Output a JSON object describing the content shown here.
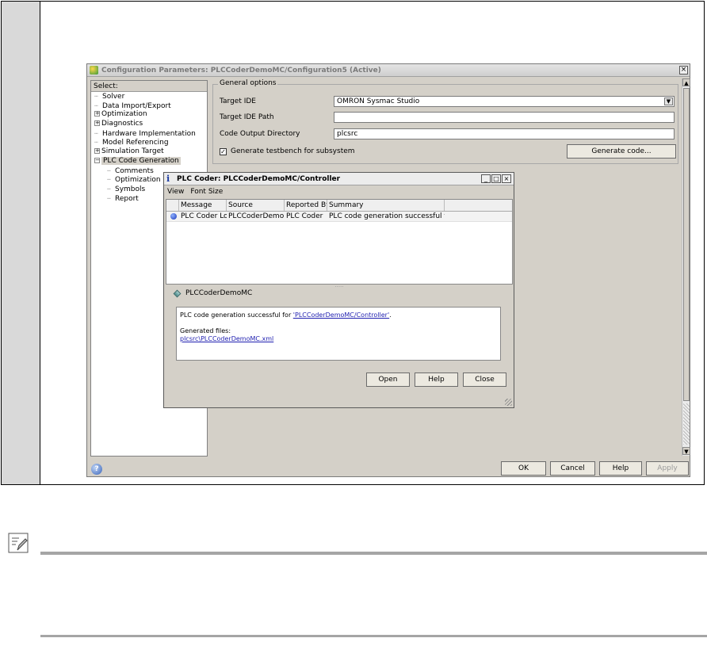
{
  "config_window": {
    "title": "Configuration Parameters: PLCCoderDemoMC/Configuration5 (Active)",
    "close_glyph": "×",
    "tree": {
      "header": "Select:",
      "items": [
        {
          "label": "Solver",
          "level": 0,
          "expander": ""
        },
        {
          "label": "Data Import/Export",
          "level": 0,
          "expander": ""
        },
        {
          "label": "Optimization",
          "level": 0,
          "expander": "+"
        },
        {
          "label": "Diagnostics",
          "level": 0,
          "expander": "+"
        },
        {
          "label": "Hardware Implementation",
          "level": 0,
          "expander": ""
        },
        {
          "label": "Model Referencing",
          "level": 0,
          "expander": ""
        },
        {
          "label": "Simulation Target",
          "level": 0,
          "expander": "+"
        },
        {
          "label": "PLC Code Generation",
          "level": 0,
          "expander": "−",
          "selected": true
        },
        {
          "label": "Comments",
          "level": 1,
          "expander": ""
        },
        {
          "label": "Optimization",
          "level": 1,
          "expander": ""
        },
        {
          "label": "Symbols",
          "level": 1,
          "expander": ""
        },
        {
          "label": "Report",
          "level": 1,
          "expander": ""
        }
      ]
    },
    "general_options": {
      "title": "General options",
      "target_ide_label": "Target IDE",
      "target_ide_value": "OMRON Sysmac Studio",
      "target_ide_path_label": "Target IDE Path",
      "target_ide_path_value": "",
      "code_output_dir_label": "Code Output Directory",
      "code_output_dir_value": "plcsrc",
      "testbench_label": "Generate testbench for subsystem",
      "testbench_checked": true,
      "generate_button": "Generate code..."
    },
    "footer_buttons": {
      "ok": "OK",
      "cancel": "Cancel",
      "help": "Help",
      "apply": "Apply"
    }
  },
  "plc_dialog": {
    "title": "PLC Coder: PLCCoderDemoMC/Controller",
    "menu": [
      "View",
      "Font Size"
    ],
    "columns": [
      "Message",
      "Source",
      "Reported By",
      "Summary"
    ],
    "rows": [
      {
        "message": "PLC Coder Log",
        "source": "PLCCoderDemoMC",
        "reported_by": "PLC Coder",
        "summary": "PLC code generation successful for 'PL..."
      }
    ],
    "node_label": "PLCCoderDemoMC",
    "message_prefix": "PLC code generation successful for ",
    "message_link": "'PLCCoderDemoMC/Controller'",
    "message_suffix": ".",
    "generated_files_label": "Generated files:",
    "generated_file_link": "plcsrc\\PLCCoderDemoMC.xml",
    "buttons": {
      "open": "Open",
      "help": "Help",
      "close": "Close"
    }
  }
}
